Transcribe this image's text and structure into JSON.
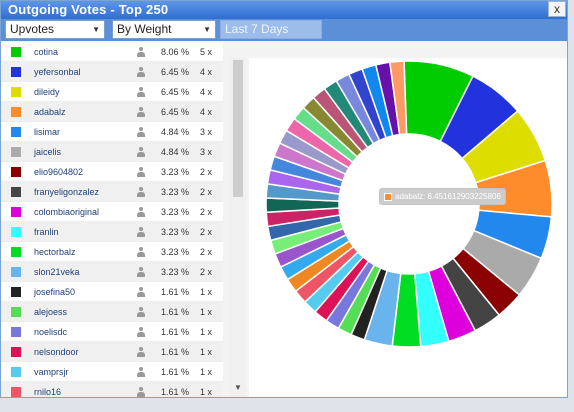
{
  "window": {
    "title": "Outgoing Votes - Top 250",
    "close_label": "x"
  },
  "toolbar": {
    "vote_type": "Upvotes",
    "sort_by": "By Weight",
    "period": "Last 7 Days"
  },
  "rows": [
    {
      "name": "cotina",
      "pct": "8.06 %",
      "count": "5 x",
      "color": "#00cc00"
    },
    {
      "name": "yefersonbal",
      "pct": "6.45 %",
      "count": "4 x",
      "color": "#2233dd"
    },
    {
      "name": "dileidy",
      "pct": "6.45 %",
      "count": "4 x",
      "color": "#dddd00"
    },
    {
      "name": "adabalz",
      "pct": "6.45 %",
      "count": "4 x",
      "color": "#ff8c2a"
    },
    {
      "name": "lisimar",
      "pct": "4.84 %",
      "count": "3 x",
      "color": "#2288ee"
    },
    {
      "name": "jaicelis",
      "pct": "4.84 %",
      "count": "3 x",
      "color": "#aaaaaa"
    },
    {
      "name": "elio9604802",
      "pct": "3.23 %",
      "count": "2 x",
      "color": "#8b0000"
    },
    {
      "name": "franyeligonzalez",
      "pct": "3.23 %",
      "count": "2 x",
      "color": "#444444"
    },
    {
      "name": "colombiaoriginal",
      "pct": "3.23 %",
      "count": "2 x",
      "color": "#dd00dd"
    },
    {
      "name": "franlin",
      "pct": "3.23 %",
      "count": "2 x",
      "color": "#33ffff"
    },
    {
      "name": "hectorbalz",
      "pct": "3.23 %",
      "count": "2 x",
      "color": "#00dd22"
    },
    {
      "name": "slon21veka",
      "pct": "3.23 %",
      "count": "2 x",
      "color": "#6ab4ee"
    },
    {
      "name": "josefina50",
      "pct": "1.61 %",
      "count": "1 x",
      "color": "#222222"
    },
    {
      "name": "alejoess",
      "pct": "1.61 %",
      "count": "1 x",
      "color": "#55dd55"
    },
    {
      "name": "noelisdc",
      "pct": "1.61 %",
      "count": "1 x",
      "color": "#7777dd"
    },
    {
      "name": "nelsondoor",
      "pct": "1.61 %",
      "count": "1 x",
      "color": "#dd1155"
    },
    {
      "name": "vamprsjr",
      "pct": "1.61 %",
      "count": "1 x",
      "color": "#55ccee"
    },
    {
      "name": "rnilo16",
      "pct": "1.61 %",
      "count": "1 x",
      "color": "#ee5566"
    }
  ],
  "tooltip": {
    "text": "adabalz: 6.451612903225806",
    "color": "#ff8c2a"
  },
  "chart_data": {
    "type": "pie",
    "donut": true,
    "start_angle_deg": -2,
    "values": [
      8.06,
      6.45,
      6.45,
      6.45,
      4.84,
      4.84,
      3.23,
      3.23,
      3.23,
      3.23,
      3.23,
      3.23,
      1.61,
      1.61,
      1.61,
      1.61,
      1.61,
      1.61,
      1.61,
      1.61,
      1.61,
      1.61,
      1.61,
      1.61,
      1.61,
      1.61,
      1.61,
      1.61,
      1.61,
      1.61,
      1.61,
      1.61,
      1.61,
      1.61,
      1.61,
      1.61,
      1.61,
      1.61,
      1.61,
      1.61
    ],
    "colors": [
      "#00cc00",
      "#2233dd",
      "#dddd00",
      "#ff8c2a",
      "#2288ee",
      "#aaaaaa",
      "#8b0000",
      "#444444",
      "#dd00dd",
      "#33ffff",
      "#00dd22",
      "#6ab4ee",
      "#222222",
      "#55dd55",
      "#7777dd",
      "#dd1155",
      "#55ccee",
      "#ee5566",
      "#ee8822",
      "#33aaee",
      "#9955cc",
      "#77ee77",
      "#3366aa",
      "#cc2266",
      "#116655",
      "#5599cc",
      "#aa66ee",
      "#4488dd",
      "#cc77cc",
      "#9999cc",
      "#ee66aa",
      "#66dd88",
      "#888833",
      "#bb5577",
      "#228877",
      "#7788dd",
      "#3344cc",
      "#1188ee",
      "#6611aa",
      "#ff9966"
    ]
  }
}
